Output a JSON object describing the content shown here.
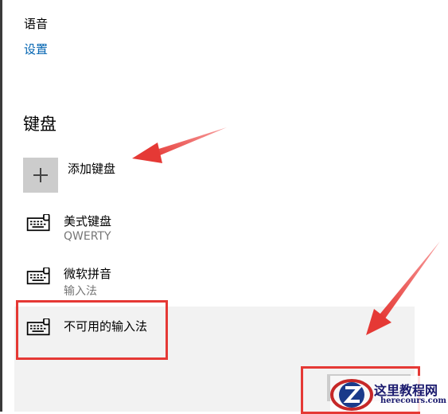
{
  "speech": {
    "label": "语音",
    "settings_link": "设置"
  },
  "keyboards": {
    "heading": "键盘",
    "add_label": "添加键盘",
    "items": [
      {
        "title": "美式键盘",
        "subtitle": "QWERTY",
        "icon": "keyboard-icon"
      },
      {
        "title": "微软拼音",
        "subtitle": "输入法",
        "icon": "keyboard-icon"
      },
      {
        "title": "不可用的输入法",
        "subtitle": "",
        "icon": "keyboard-icon",
        "selected": true
      }
    ]
  },
  "watermark": {
    "text": "这里教程网",
    "url": "herecours.com"
  },
  "colors": {
    "link": "#0063b1",
    "annotation_red": "#e53935",
    "selected_bg": "#f2f2f2",
    "tile_gray": "#cccccc"
  }
}
